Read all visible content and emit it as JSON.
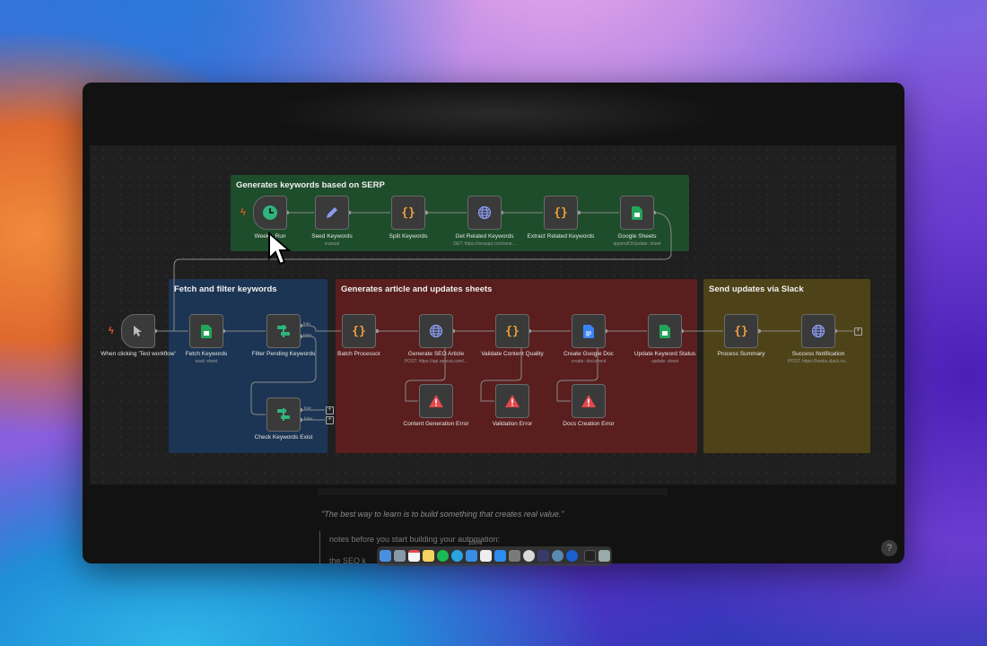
{
  "groups": {
    "serp": {
      "title": "Generates keywords based on SERP",
      "color": "#1e4d2b"
    },
    "fetch": {
      "title": "Fetch and filter keywords",
      "color": "#1c3554"
    },
    "article": {
      "title": "Generates article and updates sheets",
      "color": "#5a1e1e"
    },
    "slack": {
      "title": "Send updates via Slack",
      "color": "#4e4318"
    }
  },
  "nodes": {
    "weekly_run": {
      "label": "Weekly Run",
      "icon": "clock-icon"
    },
    "seed_keywords": {
      "label": "Seed Keywords",
      "sub": "manual",
      "icon": "pencil-icon"
    },
    "split_keywords": {
      "label": "Split Keywords",
      "icon": "code-braces-icon"
    },
    "get_related": {
      "label": "Get Related Keywords",
      "sub": "GET: https://serpapi.com/sear...",
      "icon": "globe-icon"
    },
    "extract_related": {
      "label": "Extract Related Keywords",
      "icon": "code-braces-icon"
    },
    "google_sheets": {
      "label": "Google Sheets",
      "sub": "appendOrUpdate: sheet",
      "icon": "sheets-icon"
    },
    "manual_trigger": {
      "label": "When clicking 'Test workflow'",
      "icon": "pointer-icon"
    },
    "fetch_keywords": {
      "label": "Fetch Keywords",
      "sub": "read: sheet",
      "icon": "sheets-icon"
    },
    "filter_pending": {
      "label": "Filter Pending Keywords",
      "icon": "filter-icon"
    },
    "check_exist": {
      "label": "Check Keywords Exist",
      "icon": "filter-icon"
    },
    "batch_processor": {
      "label": "Batch Processor",
      "icon": "code-braces-icon"
    },
    "generate_seo": {
      "label": "Generate SEO Article",
      "sub": "POST: https://api.openai.com/...",
      "icon": "globe-icon"
    },
    "validate_quality": {
      "label": "Validate Content Quality",
      "icon": "code-braces-icon"
    },
    "create_doc": {
      "label": "Create Google Doc",
      "sub": "create: document",
      "icon": "docs-icon"
    },
    "update_status": {
      "label": "Update Keyword Status",
      "sub": "update: sheet",
      "icon": "sheets-icon"
    },
    "content_error": {
      "label": "Content Generation Error",
      "icon": "warning-icon"
    },
    "validation_error": {
      "label": "Validation Error",
      "icon": "warning-icon"
    },
    "docs_error": {
      "label": "Docs Creation Error",
      "icon": "warning-icon"
    },
    "process_summary": {
      "label": "Process Summary",
      "icon": "code-braces-icon"
    },
    "success_notification": {
      "label": "Success Notification",
      "sub": "POST: https://hooks.slack.co...",
      "icon": "globe-icon"
    }
  },
  "branch_labels": {
    "true": "true",
    "false": "false"
  },
  "background_text": {
    "quote": "\"The best way to learn is to build something that creates real value.\"",
    "note1": "notes before you start building your automation:",
    "note2": "the SEO k"
  },
  "zoom_level": "100%",
  "help_label": "?",
  "dock_icons": [
    "finder-icon",
    "launchpad-icon",
    "calendar-icon",
    "notes-icon",
    "spotify-icon",
    "telegram-icon",
    "mail-icon",
    "notion-icon",
    "safari-icon",
    "tools-icon",
    "chrome-icon",
    "vpn-icon",
    "search-icon",
    "onepassword-icon",
    "terminal-icon",
    "trash-icon"
  ],
  "colors": {
    "accent_orange": "#f0a13a",
    "sheets_green": "#22a55a",
    "error_red": "#e5484d",
    "globe_blue": "#8a9cf2",
    "trigger_bolt": "#e0582a"
  }
}
